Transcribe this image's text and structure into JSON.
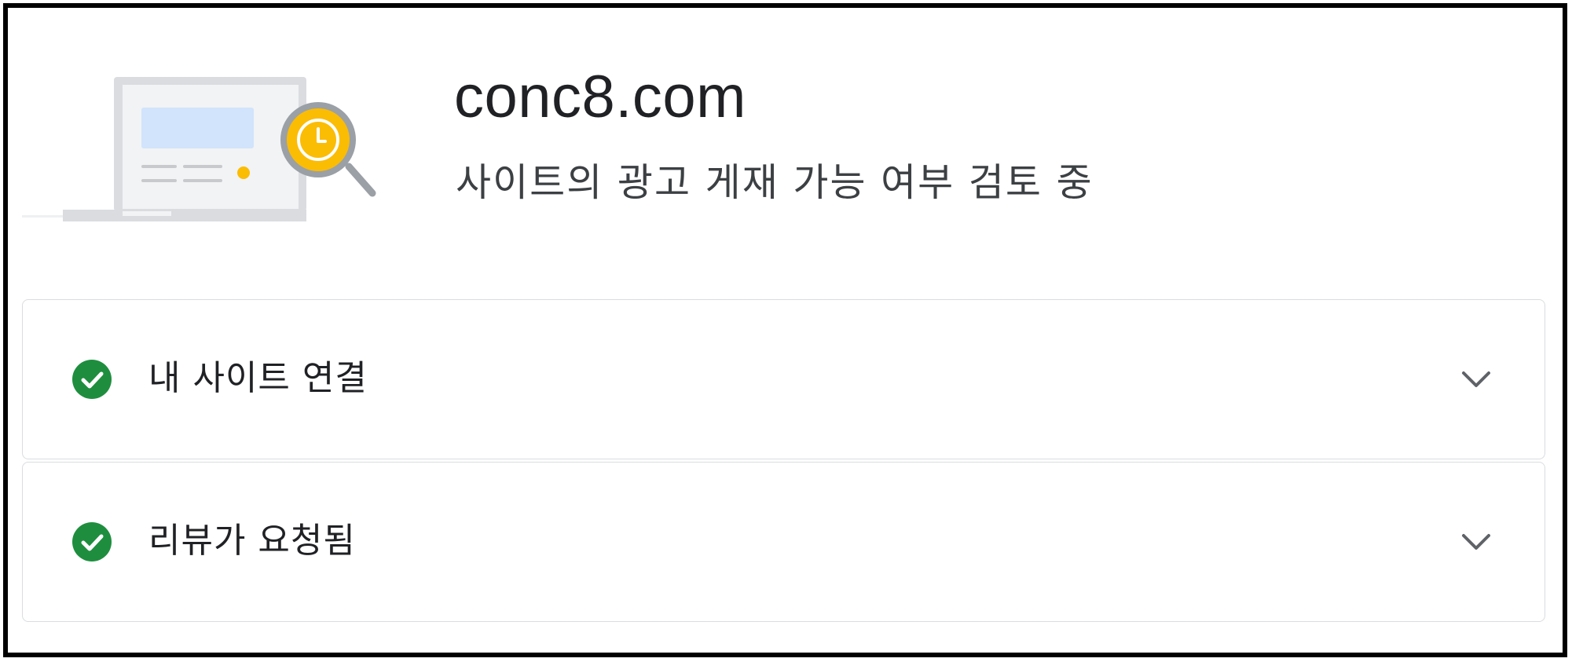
{
  "header": {
    "site_name": "conc8.com",
    "status_text": "사이트의 광고 게재 가능 여부 검토 중"
  },
  "steps": [
    {
      "label": "내 사이트 연결",
      "status": "complete",
      "icon": "check-circle-icon",
      "expand_icon": "chevron-down-icon"
    },
    {
      "label": "리뷰가 요청됨",
      "status": "complete",
      "icon": "check-circle-icon",
      "expand_icon": "chevron-down-icon"
    }
  ],
  "colors": {
    "check_green": "#1e8e3e",
    "clock_yellow": "#fbbc04",
    "screen_blue": "#d2e3fc"
  }
}
